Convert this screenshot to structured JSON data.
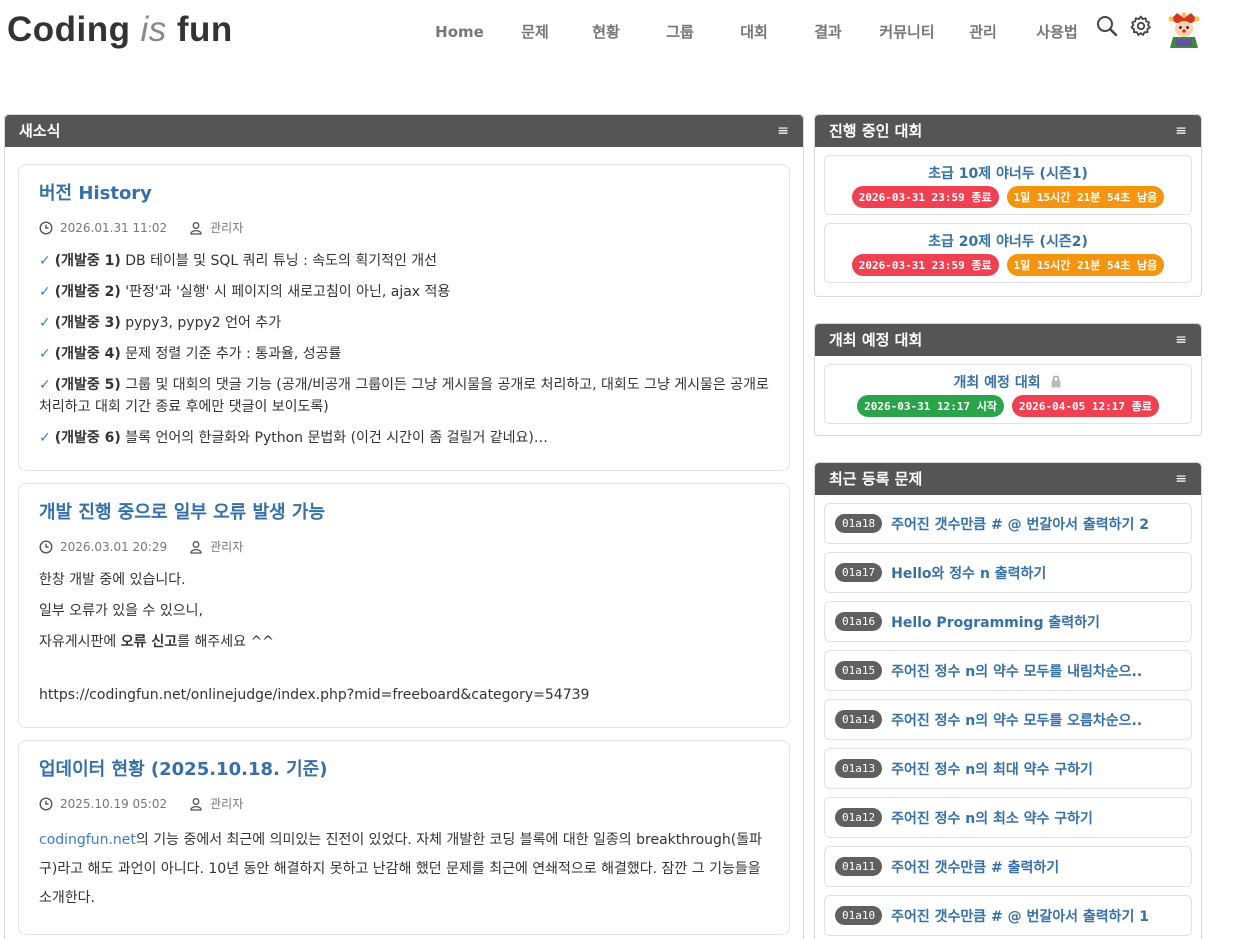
{
  "header": {
    "logo_part1": "Coding",
    "logo_part2": "is",
    "logo_part3": "fun",
    "nav": [
      "Home",
      "문제",
      "현황",
      "그룹",
      "대회",
      "결과",
      "커뮤니티",
      "관리",
      "사용법"
    ]
  },
  "news": {
    "title": "새소식",
    "menu": "≡",
    "posts": [
      {
        "title": "버전 History",
        "date": "2026.01.31 11:02",
        "author": "관리자",
        "items": [
          {
            "tag": "(개발중 1)",
            "text": " DB 테이블 및 SQL 쿼리 튜닝 : 속도의 획기적인 개선"
          },
          {
            "tag": "(개발중 2)",
            "text": " '판정'과 '실행' 시 페이지의 새로고침이 아닌, ajax 적용"
          },
          {
            "tag": "(개발중 3)",
            "text": " pypy3, pypy2 언어 추가"
          },
          {
            "tag": "(개발중 4)",
            "text": " 문제 정렬 기준 추가 : 통과율, 성공률"
          },
          {
            "tag": "(개발중 5)",
            "text": " 그룹 및 대회의 댓글 기능 (공개/비공개 그룹이든 그냥 게시물을 공개로 처리하고, 대회도 그냥 게시물은 공개로 처리하고 대회 기간 종료 후에만 댓글이 보이도록)"
          },
          {
            "tag": "(개발중 6)",
            "text": " 블록 언어의 한글화와 Python 문법화 (이건 시간이 좀 걸릴거 같네요)…"
          }
        ]
      },
      {
        "title": "개발 진행 중으로 일부 오류 발생 가능",
        "date": "2026.03.01 20:29",
        "author": "관리자",
        "line1": "한창 개발 중에 있습니다.",
        "line2": "일부 오류가 있을 수 있으니,",
        "line3_pre": "자유게시판에 ",
        "line3_bold": "오류 신고",
        "line3_post": "를 해주세요 ^^",
        "url": "https://codingfun.net/onlinejudge/index.php?mid=freeboard&category=54739"
      },
      {
        "title": "업데이터 현황 (2025.10.18. 기준)",
        "date": "2025.10.19 05:02",
        "author": "관리자",
        "link_text": "codingfun.net",
        "body": "의 기능 중에서 최근에 의미있는 진전이 있었다. 자체 개발한 코딩 블록에 대한 일종의 breakthrough(돌파구)라고 해도 과언이 아니다. 10년 동안 해결하지 못하고 난감해 했던 문제를 최근에 연쇄적으로 해결했다. 잠깐 그 기능들을 소개한다."
      }
    ]
  },
  "ongoing": {
    "title": "진행 중인 대회",
    "menu": "≡",
    "contests": [
      {
        "name": "초급 10제 야너두 (시즌1)",
        "end": "2026-03-31 23:59 종료",
        "remain": "1일 15시간 21분 54초 남음"
      },
      {
        "name": "초급 20제 야너두 (시즌2)",
        "end": "2026-03-31 23:59 종료",
        "remain": "1일 15시간 21분 54초 남음"
      }
    ]
  },
  "upcoming": {
    "title": "개최 예정 대회",
    "menu": "≡",
    "contest": {
      "name": "개최 예정 대회",
      "start": "2026-03-31 12:17 시작",
      "end": "2026-04-05 12:17 종료"
    }
  },
  "recent": {
    "title": "최근 등록 문제",
    "menu": "≡",
    "problems": [
      {
        "id": "01a18",
        "name": "주어진 갯수만큼 # @ 번갈아서 출력하기 2"
      },
      {
        "id": "01a17",
        "name": "Hello와 정수 n 출력하기"
      },
      {
        "id": "01a16",
        "name": "Hello Programming 출력하기"
      },
      {
        "id": "01a15",
        "name": "주어진 정수 n의 약수 모두를 내림차순으.."
      },
      {
        "id": "01a14",
        "name": "주어진 정수 n의 약수 모두를 오름차순으.."
      },
      {
        "id": "01a13",
        "name": "주어진 정수 n의 최대 약수 구하기"
      },
      {
        "id": "01a12",
        "name": "주어진 정수 n의 최소 약수 구하기"
      },
      {
        "id": "01a11",
        "name": "주어진 갯수만큼 # 출력하기"
      },
      {
        "id": "01a10",
        "name": "주어진 갯수만큼 # @ 번갈아서 출력하기 1"
      }
    ]
  },
  "colors": {
    "accent": "#3570a8",
    "panel_head": "#555555",
    "red": "#f04152",
    "orange": "#f5940f",
    "green": "#2aa44a"
  }
}
